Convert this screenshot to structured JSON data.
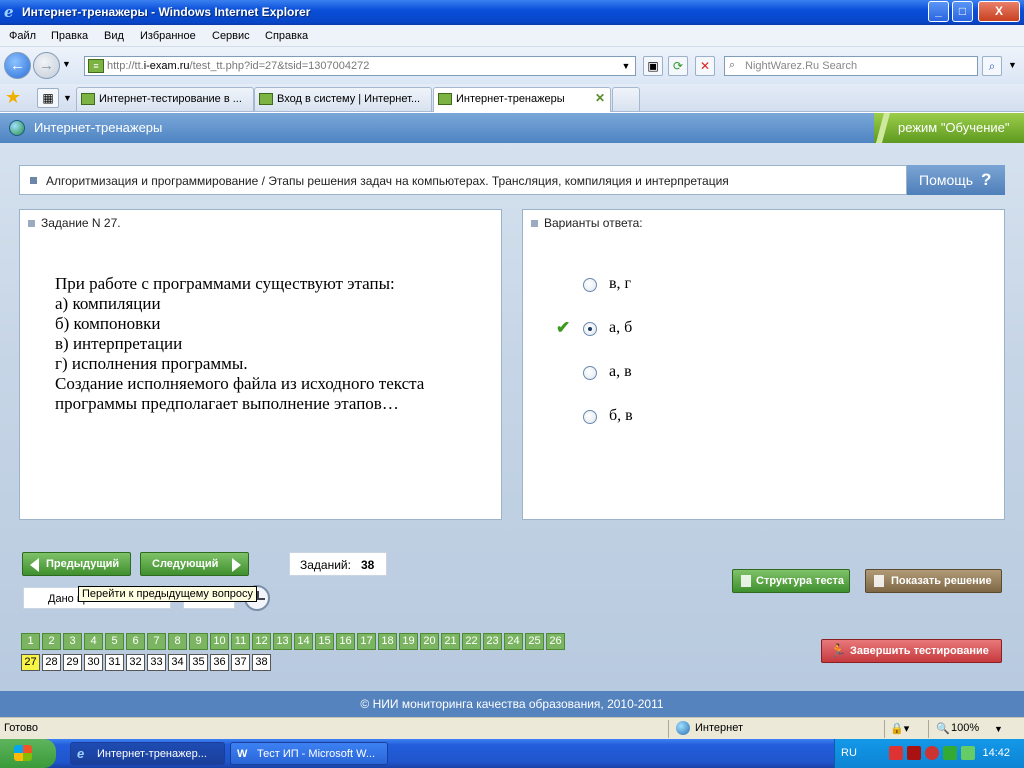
{
  "window": {
    "title": "Интернет-тренажеры - Windows Internet Explorer",
    "minimize": "_",
    "maximize": "□",
    "close": "X"
  },
  "menu": [
    "Файл",
    "Правка",
    "Вид",
    "Избранное",
    "Сервис",
    "Справка"
  ],
  "address": {
    "prefix": "http://tt.",
    "host": "i-exam.ru",
    "path": "/test_tt.php?id=27&tsid=1307004272"
  },
  "search": {
    "placeholder": "NightWarez.Ru Search"
  },
  "tabs": [
    {
      "label": "Интернет-тестирование в ...",
      "active": false
    },
    {
      "label": "Вход в систему | Интернет...",
      "active": false
    },
    {
      "label": "Интернет-тренажеры",
      "active": true
    }
  ],
  "app": {
    "name": "Интернет-тренажеры",
    "mode": "режим \"Обучение\""
  },
  "breadcrumb": "Алгоритмизация и программирование / Этапы решения задач на компьютерах. Трансляция, компиляция и интерпретация",
  "help_label": "Помощь",
  "help_icon": "?",
  "question": {
    "title": "Задание N 27.",
    "lines": [
      "При работе с программами существуют этапы:",
      "а) компиляции",
      "б) компоновки",
      "в) интерпретации",
      "г) исполнения программы.",
      "Создание исполняемого файла из исходного текста",
      "программы предполагает выполнение этапов…"
    ]
  },
  "answers": {
    "title": "Варианты ответа:",
    "options": [
      {
        "label": "в, г",
        "selected": false,
        "correct": false
      },
      {
        "label": "а, б",
        "selected": true,
        "correct": true
      },
      {
        "label": "а, в",
        "selected": false,
        "correct": false
      },
      {
        "label": "б, в",
        "selected": false,
        "correct": false
      }
    ]
  },
  "nav": {
    "prev": "Предыдущий",
    "next": "Следующий",
    "tasks_label": "Заданий:",
    "tasks_count": "38",
    "time_label": "Дано времени:",
    "tooltip": "Перейти к предыдущему вопросу"
  },
  "buttons": {
    "structure": "Структура теста",
    "solution": "Показать решение",
    "finish": "Завершить тестирование"
  },
  "question_numbers": {
    "answered": [
      "1",
      "2",
      "3",
      "4",
      "5",
      "6",
      "7",
      "8",
      "9",
      "10",
      "11",
      "12",
      "13",
      "14",
      "15",
      "16",
      "17",
      "18",
      "19",
      "20",
      "21",
      "22",
      "23",
      "24",
      "25",
      "26"
    ],
    "current": "27",
    "remaining": [
      "28",
      "29",
      "30",
      "31",
      "32",
      "33",
      "34",
      "35",
      "36",
      "37",
      "38"
    ]
  },
  "footer": "© НИИ мониторинга качества образования, 2010-2011",
  "status": {
    "left": "Готово",
    "zone": "Интернет",
    "zoom": "100%"
  },
  "taskbar": {
    "items": [
      "Интернет-тренажер...",
      "Тест ИП - Microsoft W..."
    ],
    "lang": "RU",
    "time": "14:42"
  },
  "colors": {
    "accent_green": "#3f8f2e",
    "header_blue": "#4e84c2",
    "current_question": "#f7f347"
  }
}
